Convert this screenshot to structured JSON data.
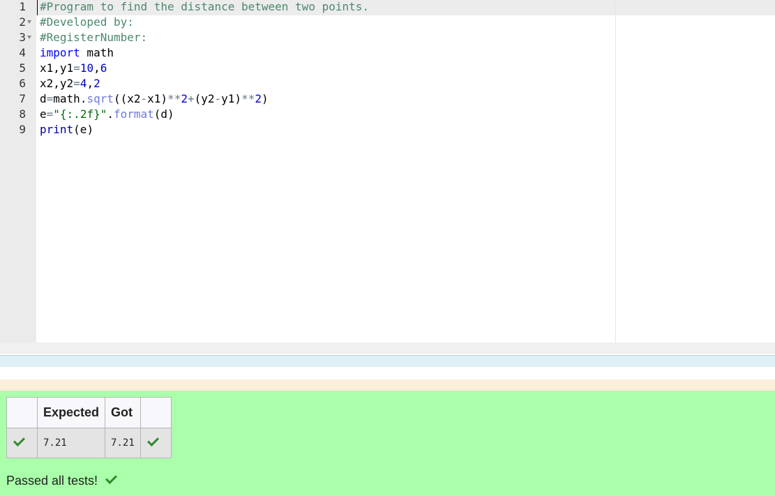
{
  "editor": {
    "lines": [
      {
        "number": "1",
        "fold": false,
        "tokens": [
          {
            "cls": "cm-comment",
            "text": "#Program to find the distance between two points."
          }
        ]
      },
      {
        "number": "2",
        "fold": true,
        "tokens": [
          {
            "cls": "cm-comment",
            "text": "#Developed by:"
          }
        ]
      },
      {
        "number": "3",
        "fold": true,
        "tokens": [
          {
            "cls": "cm-comment",
            "text": "#RegisterNumber:"
          }
        ]
      },
      {
        "number": "4",
        "fold": false,
        "tokens": [
          {
            "cls": "cm-keyword",
            "text": "import"
          },
          {
            "cls": "",
            "text": " math"
          }
        ]
      },
      {
        "number": "5",
        "fold": false,
        "tokens": [
          {
            "cls": "",
            "text": "x1,y1"
          },
          {
            "cls": "cm-op",
            "text": "="
          },
          {
            "cls": "cm-number",
            "text": "10"
          },
          {
            "cls": "",
            "text": ","
          },
          {
            "cls": "cm-number",
            "text": "6"
          }
        ]
      },
      {
        "number": "6",
        "fold": false,
        "tokens": [
          {
            "cls": "",
            "text": "x2,y2"
          },
          {
            "cls": "cm-op",
            "text": "="
          },
          {
            "cls": "cm-number",
            "text": "4"
          },
          {
            "cls": "",
            "text": ","
          },
          {
            "cls": "cm-number",
            "text": "2"
          }
        ]
      },
      {
        "number": "7",
        "fold": false,
        "tokens": [
          {
            "cls": "",
            "text": "d"
          },
          {
            "cls": "cm-op",
            "text": "="
          },
          {
            "cls": "",
            "text": "math."
          },
          {
            "cls": "cm-support",
            "text": "sqrt"
          },
          {
            "cls": "",
            "text": "((x2"
          },
          {
            "cls": "cm-op",
            "text": "-"
          },
          {
            "cls": "",
            "text": "x1)"
          },
          {
            "cls": "cm-op",
            "text": "**"
          },
          {
            "cls": "cm-number",
            "text": "2"
          },
          {
            "cls": "cm-op",
            "text": "+"
          },
          {
            "cls": "",
            "text": "(y2"
          },
          {
            "cls": "cm-op",
            "text": "-"
          },
          {
            "cls": "",
            "text": "y1)"
          },
          {
            "cls": "cm-op",
            "text": "**"
          },
          {
            "cls": "cm-number",
            "text": "2"
          },
          {
            "cls": "",
            "text": ")"
          }
        ]
      },
      {
        "number": "8",
        "fold": false,
        "tokens": [
          {
            "cls": "",
            "text": "e"
          },
          {
            "cls": "cm-op",
            "text": "="
          },
          {
            "cls": "cm-string",
            "text": "\"{:.2f}\""
          },
          {
            "cls": "",
            "text": "."
          },
          {
            "cls": "cm-support",
            "text": "format"
          },
          {
            "cls": "",
            "text": "(d)"
          }
        ]
      },
      {
        "number": "9",
        "fold": false,
        "tokens": [
          {
            "cls": "cm-builtin",
            "text": "print"
          },
          {
            "cls": "",
            "text": "(e)"
          }
        ]
      }
    ]
  },
  "results": {
    "headers": {
      "status": "",
      "expected": "Expected",
      "got": "Got",
      "status2": ""
    },
    "rows": [
      {
        "expected": "7.21",
        "got": "7.21",
        "passed": true
      }
    ],
    "summary": "Passed all tests!"
  },
  "colors": {
    "results_bg": "#aaffaa",
    "tick": "#2f8a2f",
    "comment": "#4c886b",
    "keyword": "#0000ff"
  },
  "icons": {
    "fold": "chevron-down-icon",
    "pass": "check-icon"
  }
}
